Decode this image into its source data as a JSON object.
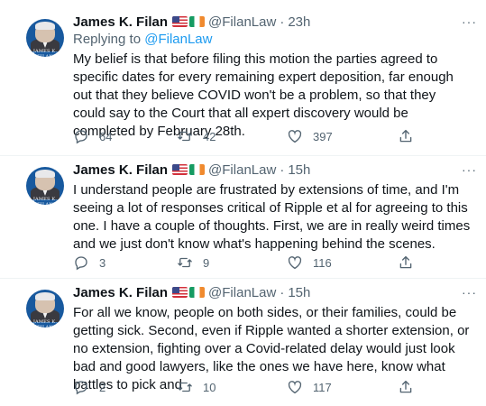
{
  "tweets": [
    {
      "author": "James K. Filan",
      "handle": "@FilanLaw",
      "separator": "·",
      "time": "23h",
      "replying_prefix": "Replying to ",
      "replying_to": "@FilanLaw",
      "text": "My belief is that before filing this motion the parties agreed to specific dates for every remaining expert deposition, far enough out that they believe COVID won't be a problem, so that they could say to the Court that all expert discovery would be completed by February 28th.",
      "replies": "64",
      "retweets": "42",
      "likes": "397"
    },
    {
      "author": "James K. Filan",
      "handle": "@FilanLaw",
      "separator": "·",
      "time": "15h",
      "text": "I understand people are frustrated by extensions of time, and I'm seeing a lot of responses critical of Ripple et al for agreeing to this one.  I have a couple of thoughts.  First, we are in really weird times and we just don't know what's happening behind the scenes.",
      "replies": "3",
      "retweets": "9",
      "likes": "116"
    },
    {
      "author": "James K. Filan",
      "handle": "@FilanLaw",
      "separator": "·",
      "time": "15h",
      "text": "For all we know, people on both sides, or their families, could be getting sick. Second, even if Ripple wanted a shorter extension, or no extension, fighting over a Covid-related delay would just look bad and good lawyers, like the ones we have here, know what battles to pick and",
      "replies": "2",
      "retweets": "10",
      "likes": "117"
    }
  ],
  "avatar_text": "JAMES K. FILAN",
  "more_label": "···",
  "icons": {
    "reply": "reply-icon",
    "retweet": "retweet-icon",
    "like": "heart-icon",
    "share": "share-icon",
    "more": "more-icon",
    "flag_us": "us-flag-icon",
    "flag_ie": "ireland-flag-icon"
  },
  "colors": {
    "link": "#1d9bf0",
    "secondary_text": "#536471",
    "primary_text": "#0f1419",
    "avatar_bg": "#18599e"
  }
}
